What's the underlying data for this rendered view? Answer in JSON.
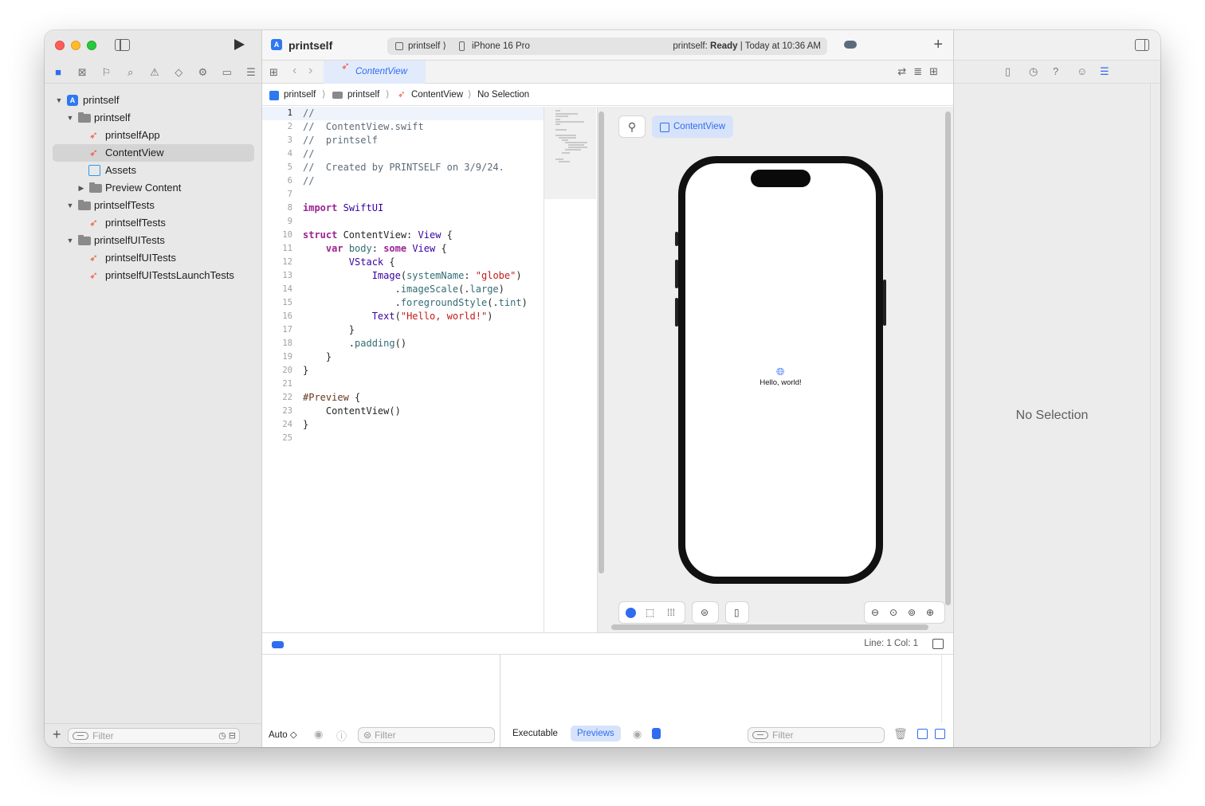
{
  "window": {
    "project": "printself"
  },
  "sidebar": {
    "tree": [
      {
        "label": "printself",
        "icon": "app-icon",
        "indent": 0,
        "chevron": "open"
      },
      {
        "label": "printself",
        "icon": "folder-icon",
        "indent": 1,
        "chevron": "open"
      },
      {
        "label": "printselfApp",
        "icon": "swift-file-icon",
        "indent": 2
      },
      {
        "label": "ContentView",
        "icon": "swift-file-icon",
        "indent": 2,
        "selected": true
      },
      {
        "label": "Assets",
        "icon": "assets-icon",
        "indent": 2
      },
      {
        "label": "Preview Content",
        "icon": "folder-icon",
        "indent": 2,
        "chevron": "closed"
      },
      {
        "label": "printselfTests",
        "icon": "folder-icon",
        "indent": 1,
        "chevron": "open"
      },
      {
        "label": "printselfTests",
        "icon": "swift-file-icon",
        "indent": 2
      },
      {
        "label": "printselfUITests",
        "icon": "folder-icon",
        "indent": 1,
        "chevron": "open"
      },
      {
        "label": "printselfUITests",
        "icon": "swift-file-icon",
        "indent": 2
      },
      {
        "label": "printselfUITestsLaunchTests",
        "icon": "swift-file-icon",
        "indent": 2
      }
    ],
    "filter_placeholder": "Filter"
  },
  "toolbar": {
    "scheme": "printself",
    "destination": "iPhone 16 Pro",
    "status_prefix": "printself: ",
    "status_bold": "Ready",
    "status_suffix": " | Today at 10:36 AM"
  },
  "editor": {
    "tab": "ContentView",
    "breadcrumb": [
      "printself",
      "printself",
      "ContentView",
      "No Selection"
    ],
    "current_line": 1,
    "lines": [
      "//",
      "//  ContentView.swift",
      "//  printself",
      "//",
      "//  Created by PRINTSELF on 3/9/24.",
      "//",
      "",
      "import SwiftUI",
      "",
      "struct ContentView: View {",
      "    var body: some View {",
      "        VStack {",
      "            Image(systemName: \"globe\")",
      "                .imageScale(.large)",
      "                .foregroundStyle(.tint)",
      "            Text(\"Hello, world!\")",
      "        }",
      "        .padding()",
      "    }",
      "}",
      "",
      "#Preview {",
      "    ContentView()",
      "}",
      ""
    ]
  },
  "preview": {
    "button": "ContentView",
    "text": "Hello, world!"
  },
  "status": {
    "line_col": "Line: 1  Col: 1"
  },
  "debug": {
    "auto": "Auto ◇",
    "filter_left": "Filter",
    "executable": "Executable",
    "previews": "Previews",
    "filter_right": "Filter"
  },
  "inspector": {
    "empty": "No Selection"
  }
}
